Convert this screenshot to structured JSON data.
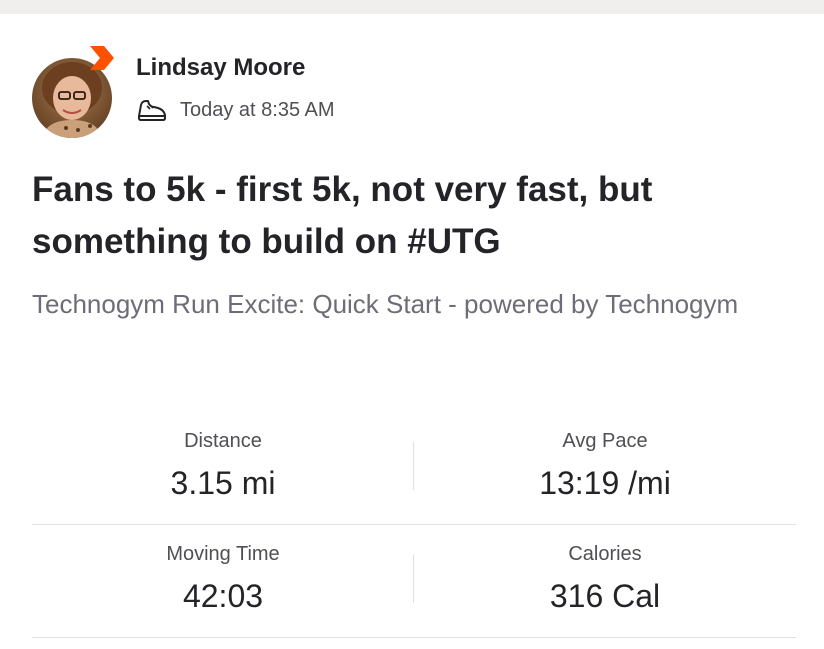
{
  "colors": {
    "accent": "#fc5200",
    "text_primary": "#242428",
    "text_secondary": "#6d6d78",
    "divider": "#dfdfe8"
  },
  "header": {
    "athlete_name": "Lindsay Moore",
    "timestamp": "Today at 8:35 AM",
    "activity_icon": "shoe-icon",
    "badge_icon": "subscriber-chevron-icon"
  },
  "activity": {
    "title": "Fans to 5k - first 5k, not very fast, but something to build on #UTG",
    "device": "Technogym Run Excite: Quick Start - powered by Technogym"
  },
  "stats": [
    {
      "label": "Distance",
      "value": "3.15 mi"
    },
    {
      "label": "Avg Pace",
      "value": "13:19 /mi"
    },
    {
      "label": "Moving Time",
      "value": "42:03"
    },
    {
      "label": "Calories",
      "value": "316 Cal"
    }
  ]
}
